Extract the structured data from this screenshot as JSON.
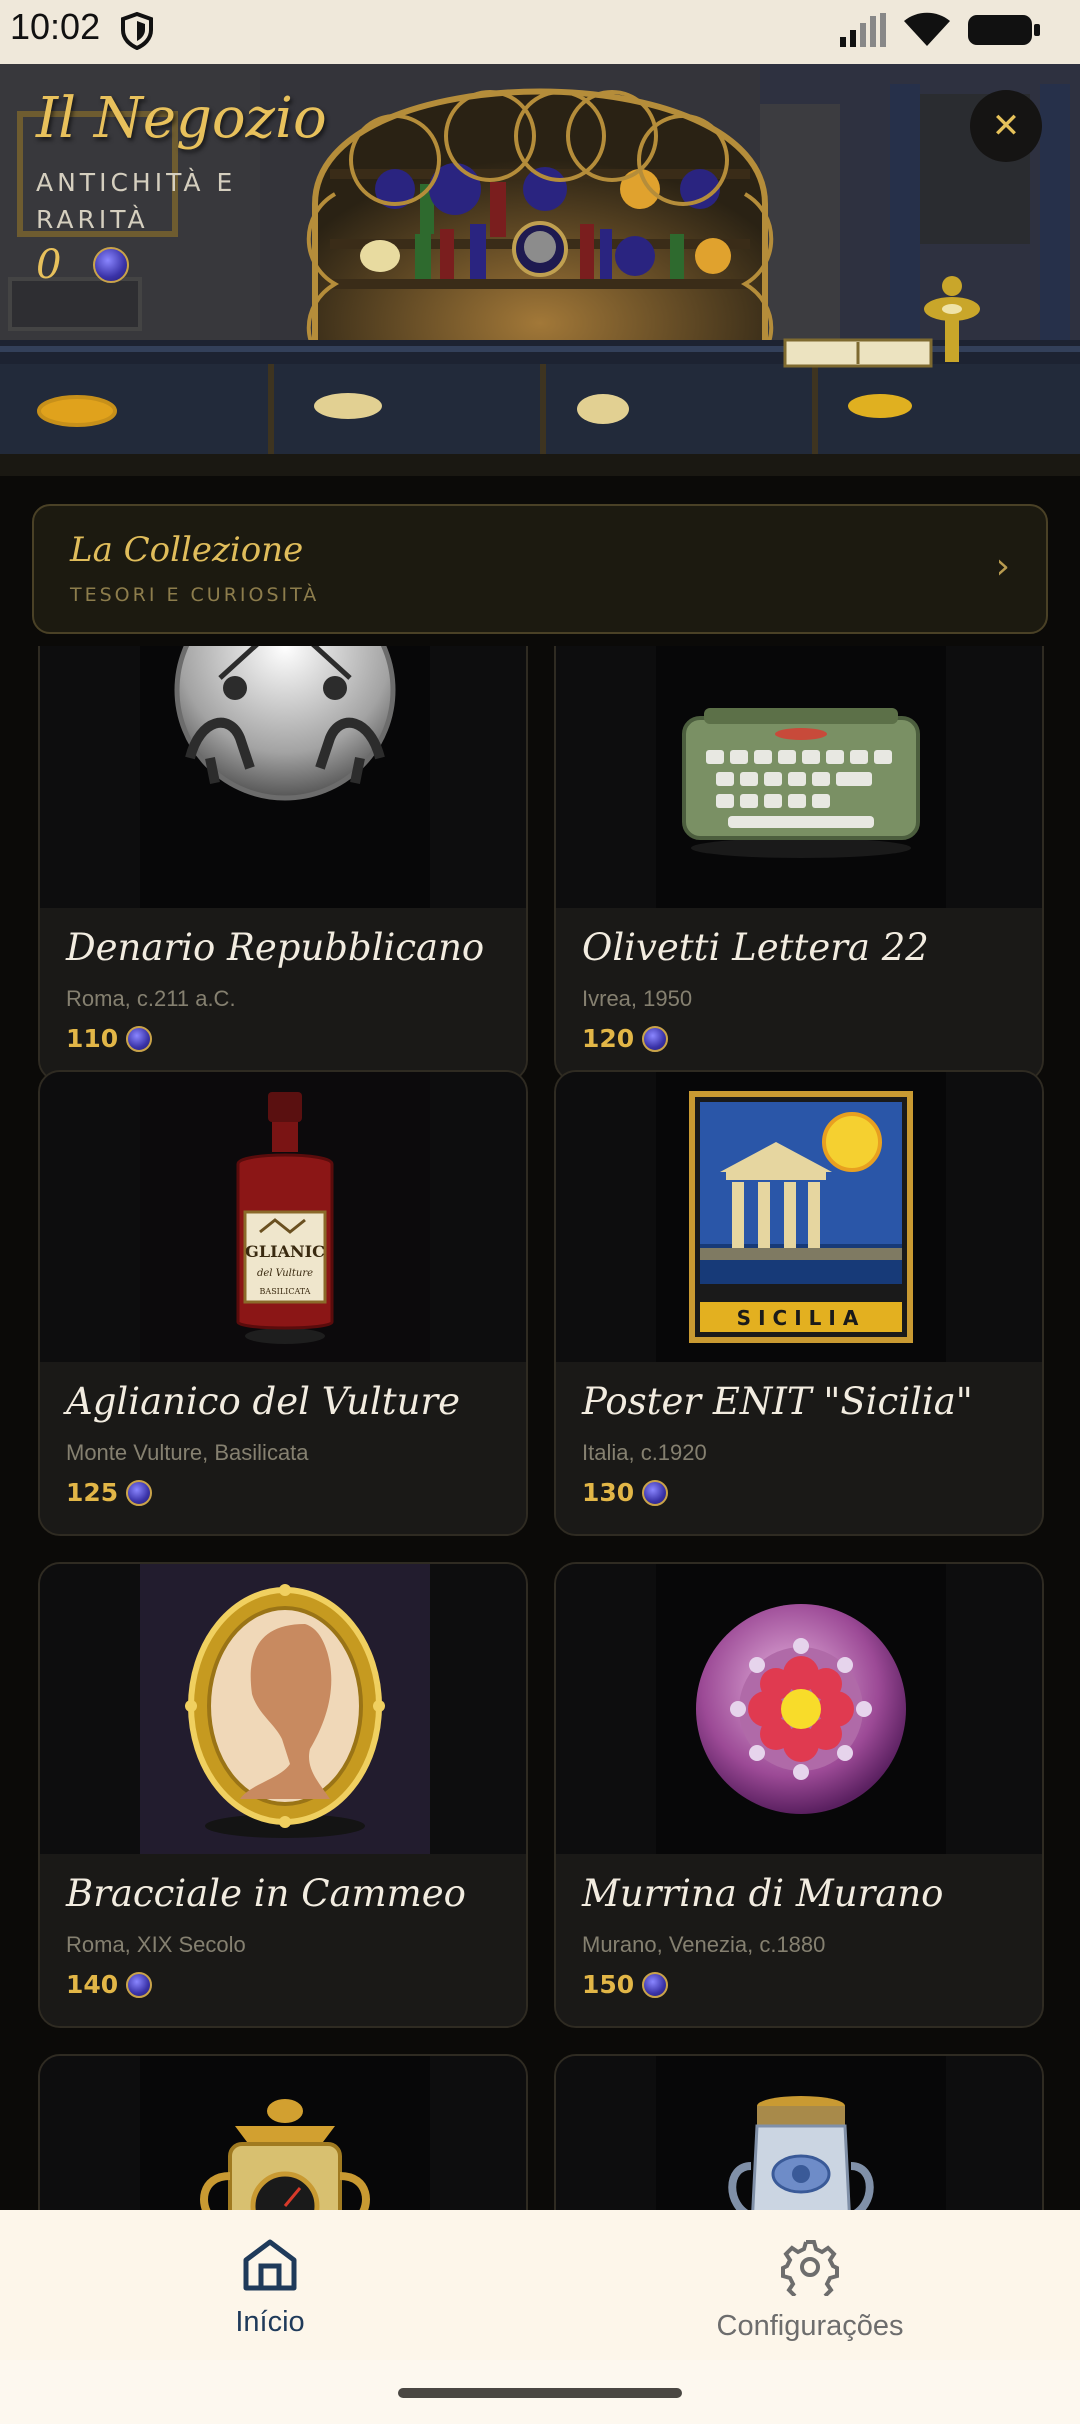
{
  "status": {
    "time": "10:02"
  },
  "hero": {
    "title": "Il Negozio",
    "subtitle": "ANTICHITÀ E RARITÀ",
    "coins": "0",
    "close_label": "✕"
  },
  "collection": {
    "title": "La Collezione",
    "subtitle": "TESORI E CURIOSITÀ",
    "chevron": "›"
  },
  "items": [
    {
      "name": "Denario Repubblicano",
      "origin": "Roma, c.211 a.C.",
      "price": "110",
      "icon": "roman-coin-icon"
    },
    {
      "name": "Olivetti Lettera 22",
      "origin": "Ivrea, 1950",
      "price": "120",
      "icon": "typewriter-icon"
    },
    {
      "name": "Aglianico del Vulture",
      "origin": "Monte Vulture, Basilicata",
      "price": "125",
      "icon": "wine-bottle-icon",
      "label_main": "GLIANIC",
      "label_sub": "del Vulture",
      "label_foot": "BASILICATA"
    },
    {
      "name": "Poster ENIT \"Sicilia\"",
      "origin": "Italia, c.1920",
      "price": "130",
      "icon": "travel-poster-icon",
      "poster_text": "SICILIA"
    },
    {
      "name": "Bracciale in Cammeo",
      "origin": "Roma, XIX Secolo",
      "price": "140",
      "icon": "cameo-icon"
    },
    {
      "name": "Murrina di Murano",
      "origin": "Murano, Venezia, c.1880",
      "price": "150",
      "icon": "murano-glass-icon"
    },
    {
      "name": "",
      "origin": "",
      "price": "",
      "icon": "moka-clock-icon"
    },
    {
      "name": "",
      "origin": "",
      "price": "",
      "icon": "ceramic-jar-icon"
    }
  ],
  "nav": {
    "home_label": "Início",
    "settings_label": "Configurações",
    "active_color": "#1f3a5a",
    "inactive_color": "#6d6d6d"
  },
  "colors": {
    "gold": "#e8c15c",
    "coin_blue": "#3a33a8",
    "background": "#0b0a08"
  }
}
